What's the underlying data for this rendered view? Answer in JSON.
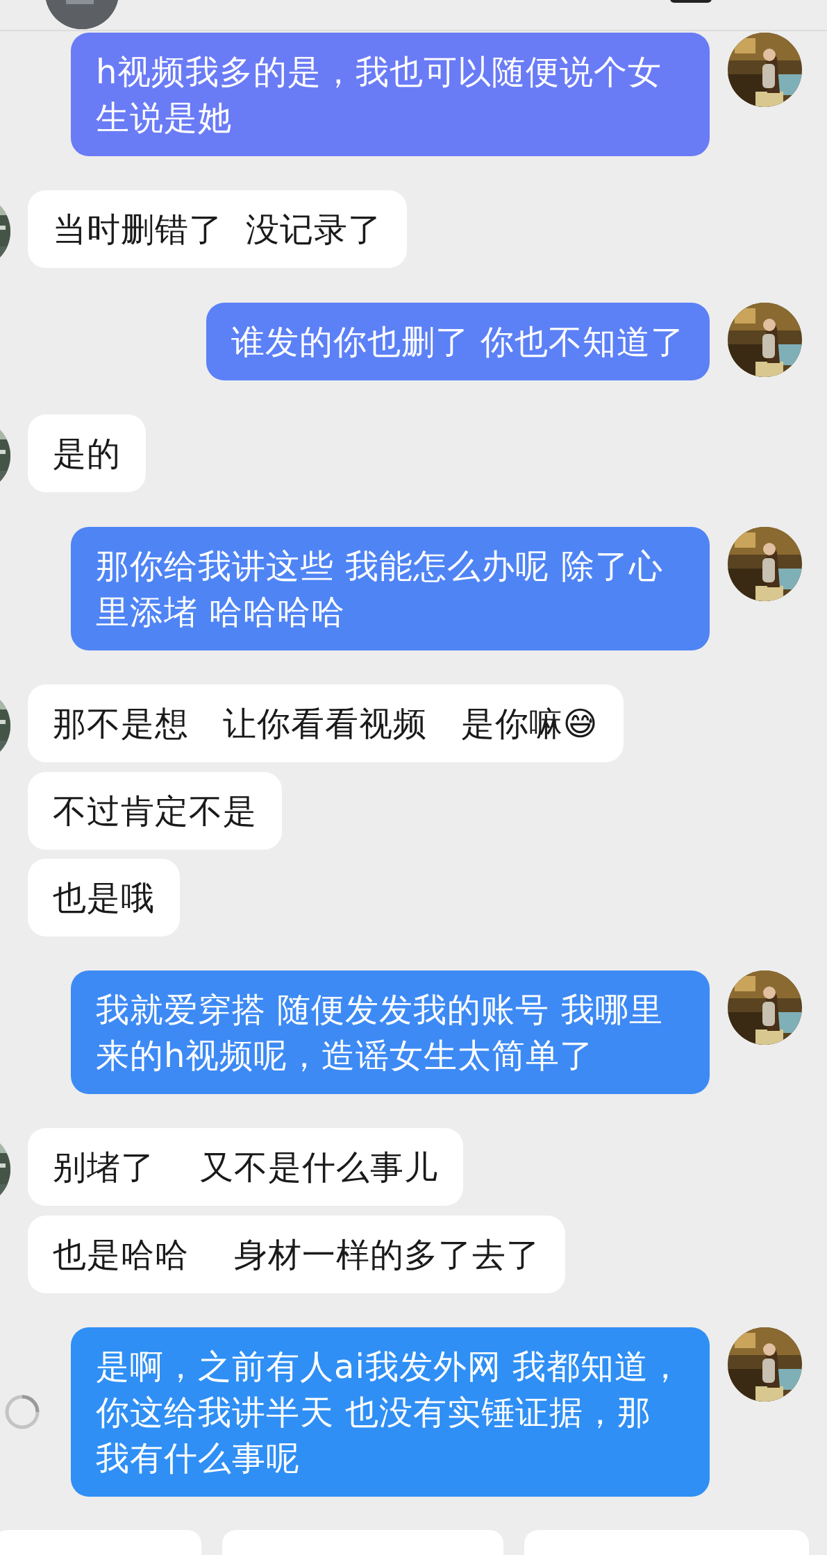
{
  "messages": [
    {
      "kind": "sent",
      "text": "h视频我多的是，我也可以随便说个女生说是她",
      "color": "#6a7bf6",
      "avatar": true
    },
    {
      "kind": "received",
      "text": "当时删错了  没记录了",
      "avatar": true
    },
    {
      "kind": "sent",
      "text": "谁发的你也删了 你也不知道了",
      "color": "#5c80f6",
      "avatar": true
    },
    {
      "kind": "received",
      "text": "是的",
      "avatar": true
    },
    {
      "kind": "sent",
      "text": "那你给我讲这些 我能怎么办呢 除了心里添堵 哈哈哈哈",
      "color": "#4f84f5",
      "avatar": true
    },
    {
      "kind": "received",
      "text": "那不是想   让你看看视频   是你嘛😅",
      "avatar": true
    },
    {
      "kind": "received",
      "text": "不过肯定不是",
      "avatar": false
    },
    {
      "kind": "received",
      "text": "也是哦",
      "avatar": false
    },
    {
      "kind": "sent",
      "text": "我就爱穿搭 随便发发我的账号 我哪里来的h视频呢，造谣女生太简单了",
      "color": "#3d8af5",
      "avatar": true
    },
    {
      "kind": "received",
      "text": "别堵了    又不是什么事儿",
      "avatar": true
    },
    {
      "kind": "received",
      "text": "也是哈哈    身材一样的多了去了",
      "avatar": false
    },
    {
      "kind": "sent",
      "text": "是啊，之前有人ai我发外网 我都知道，你这给我讲半天 也没有实锤证据，那我有什么事呢",
      "color": "#2f8ff5",
      "avatar": true,
      "sending": true
    }
  ]
}
